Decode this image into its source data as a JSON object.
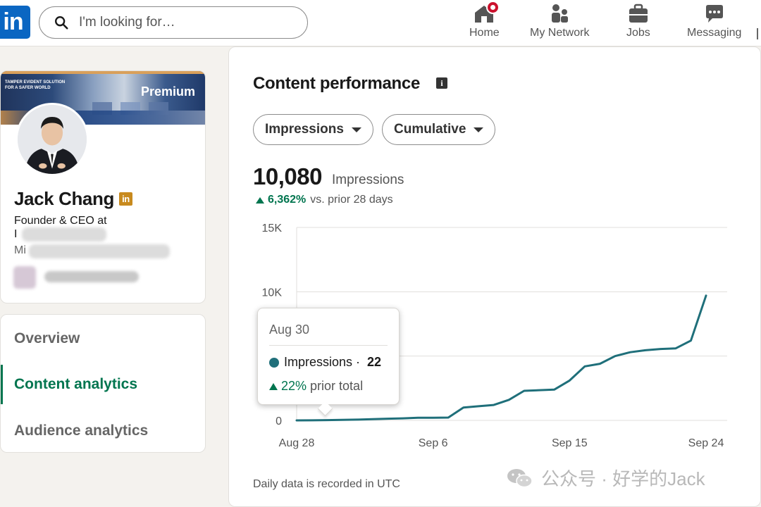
{
  "nav": {
    "search_placeholder": "I'm looking for…",
    "items": [
      {
        "label": "Home",
        "icon": "home-icon"
      },
      {
        "label": "My Network",
        "icon": "network-icon"
      },
      {
        "label": "Jobs",
        "icon": "briefcase-icon"
      },
      {
        "label": "Messaging",
        "icon": "messaging-icon"
      }
    ],
    "logo": "in"
  },
  "profile": {
    "banner_label": "Premium",
    "banner_text": "TAMPER EVIDENT SOLUTION\nFOR A SAFER WORLD",
    "name": "Jack Chang",
    "badge": "in",
    "headline": "Founder & CEO at",
    "headline_line2": "I",
    "location": "Mi"
  },
  "side_nav": {
    "items": [
      {
        "label": "Overview",
        "active": false
      },
      {
        "label": "Content analytics",
        "active": true
      },
      {
        "label": "Audience analytics",
        "active": false
      }
    ]
  },
  "main": {
    "title": "Content performance",
    "info_icon": "i",
    "filters": {
      "metric": "Impressions",
      "mode": "Cumulative"
    },
    "total": "10,080",
    "total_label": "Impressions",
    "delta_value": "6,362%",
    "delta_text": "vs. prior 28 days",
    "footer": "Daily data is recorded in UTC",
    "tooltip": {
      "date": "Aug 30",
      "series": "Impressions",
      "value": "22",
      "delta_value": "22%",
      "delta_text": "prior total"
    }
  },
  "chart_data": {
    "type": "line",
    "series": [
      {
        "values": [
          0,
          5,
          22,
          40,
          60,
          100,
          130,
          160,
          200,
          210,
          220,
          1000,
          1100,
          1200,
          1600,
          2300,
          2350,
          2400,
          3100,
          4200,
          4400,
          5000,
          5300,
          5450,
          5550,
          5600,
          6200,
          9700,
          10050,
          10080
        ]
      }
    ],
    "x": [
      "Aug 28",
      "Aug 29",
      "Aug 30",
      "Aug 31",
      "Sep 1",
      "Sep 2",
      "Sep 3",
      "Sep 4",
      "Sep 5",
      "Sep 6",
      "Sep 7",
      "Sep 8",
      "Sep 9",
      "Sep 10",
      "Sep 11",
      "Sep 12",
      "Sep 13",
      "Sep 14",
      "Sep 15",
      "Sep 16",
      "Sep 17",
      "Sep 18",
      "Sep 19",
      "Sep 20",
      "Sep 21",
      "Sep 22",
      "Sep 23",
      "Sep 24",
      "Sep 25",
      "Sep 26"
    ],
    "x_ticks": [
      "Aug 28",
      "Sep 6",
      "Sep 15",
      "Sep 24"
    ],
    "y_ticks": [
      "0",
      "5K",
      "10K",
      "15K"
    ],
    "y_tick_values": [
      0,
      5000,
      10000,
      15000
    ],
    "ylim": [
      0,
      15000
    ],
    "grid": true,
    "line_color": "#1f6f7a"
  },
  "watermark": "公众号 · 好学的Jack",
  "colors": {
    "brand": "#0a66c2",
    "accent_green": "#01754f",
    "line": "#1f6f7a",
    "notification": "#cb112d"
  }
}
